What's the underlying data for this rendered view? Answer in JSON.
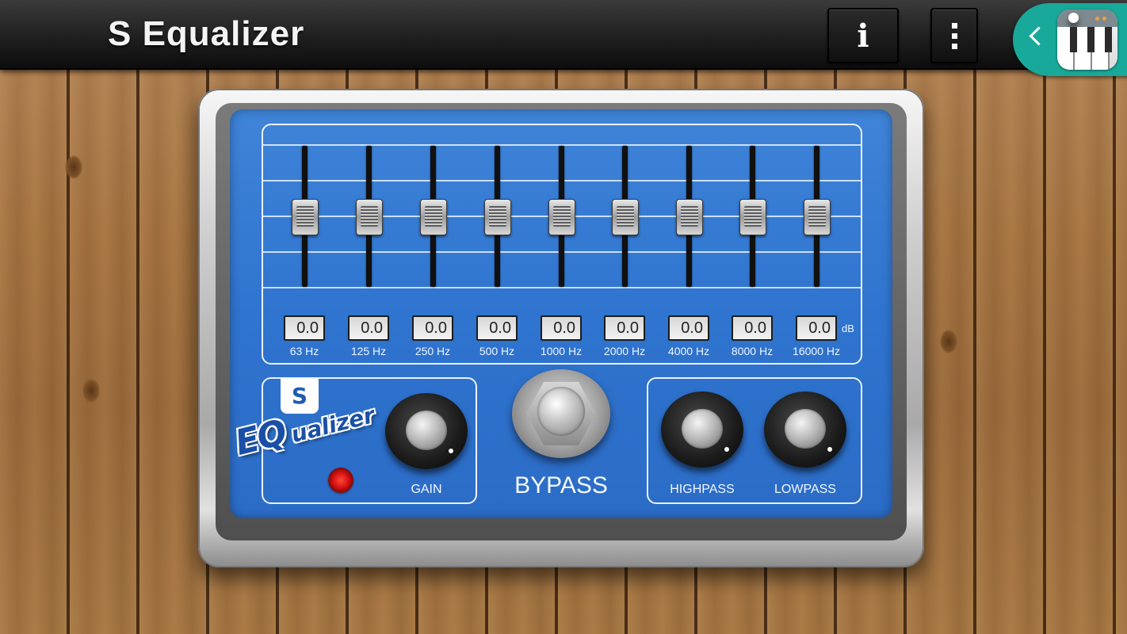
{
  "app": {
    "title": "S Equalizer",
    "info_label": "i",
    "menu_icon": "overflow-menu-icon",
    "side_app_icon": "piano-app-icon"
  },
  "equalizer": {
    "unit": "dB",
    "bands": [
      {
        "freq": "63 Hz",
        "value": "0.0"
      },
      {
        "freq": "125 Hz",
        "value": "0.0"
      },
      {
        "freq": "250 Hz",
        "value": "0.0"
      },
      {
        "freq": "500 Hz",
        "value": "0.0"
      },
      {
        "freq": "1000 Hz",
        "value": "0.0"
      },
      {
        "freq": "2000 Hz",
        "value": "0.0"
      },
      {
        "freq": "4000 Hz",
        "value": "0.0"
      },
      {
        "freq": "8000 Hz",
        "value": "0.0"
      },
      {
        "freq": "16000 Hz",
        "value": "0.0"
      }
    ]
  },
  "brand": {
    "logo_letter": "S",
    "name_prefix": "EQ",
    "name_suffix": "ualizer"
  },
  "controls": {
    "gain_label": "GAIN",
    "bypass_label": "BYPASS",
    "highpass_label": "HIGHPASS",
    "lowpass_label": "LOWPASS"
  },
  "colors": {
    "face_blue": "#2f74cf",
    "side_tab_teal": "#19a99a",
    "led_red": "#d40f0f"
  }
}
